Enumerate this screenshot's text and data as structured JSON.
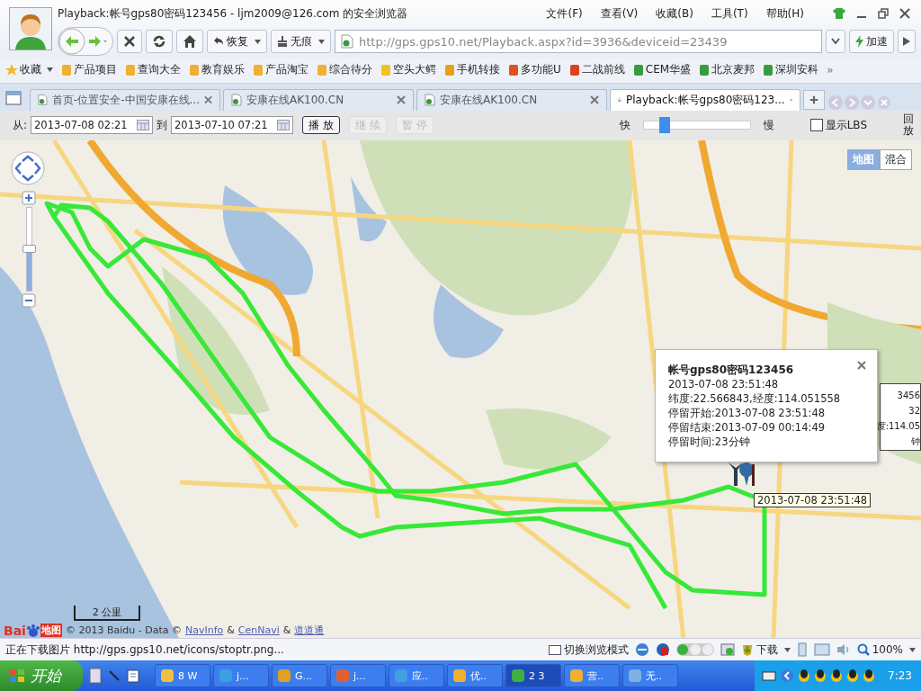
{
  "window": {
    "title": "Playback:帐号gps80密码123456 - ljm2009@126.com 的安全浏览器"
  },
  "menu": [
    "文件(F)",
    "查看(V)",
    "收藏(B)",
    "工具(T)",
    "帮助(H)"
  ],
  "toolbar": {
    "restore": "恢复",
    "incognito": "无痕",
    "address": "http://gps.gps10.net/Playback.aspx?id=3936&deviceid=23439",
    "accelerate": "加速"
  },
  "bookmarks": {
    "favorites": "收藏",
    "items": [
      {
        "label": "产品项目",
        "kind": "folder"
      },
      {
        "label": "查询大全",
        "kind": "folder"
      },
      {
        "label": "教育娱乐",
        "kind": "folder"
      },
      {
        "label": "产品淘宝",
        "kind": "folder"
      },
      {
        "label": "综合待分",
        "kind": "folder"
      },
      {
        "label": "空头大鳄",
        "kind": "hand"
      },
      {
        "label": "手机转接",
        "kind": "flag"
      },
      {
        "label": "多功能U",
        "kind": "tao"
      },
      {
        "label": "二战前线",
        "kind": "pin"
      },
      {
        "label": "CEM华盛",
        "kind": "page"
      },
      {
        "label": "北京麦邦",
        "kind": "page"
      },
      {
        "label": "深圳安科",
        "kind": "page"
      }
    ],
    "more": "»"
  },
  "tabs": [
    {
      "label": "首页-位置安全-中国安康在线...",
      "selected": false
    },
    {
      "label": "安康在线AK100.CN",
      "selected": false
    },
    {
      "label": "安康在线AK100.CN",
      "selected": false
    },
    {
      "label": "Playback:帐号gps80密码123...",
      "selected": true
    }
  ],
  "controls": {
    "from_label": "从:",
    "from": "2013-07-08 02:21",
    "to_label": "到",
    "to": "2013-07-10 07:21",
    "buttons": [
      {
        "label": "播 放",
        "disabled": false
      },
      {
        "label": "继 续",
        "disabled": true
      },
      {
        "label": "暂 停",
        "disabled": true
      }
    ],
    "fast": "快",
    "speed": {
      "level": 0.15
    },
    "slow": "慢",
    "lbs": {
      "label": "显示LBS",
      "checked": false
    },
    "help": "回放"
  },
  "map": {
    "types": [
      {
        "label": "地图",
        "selected": true
      },
      {
        "label": "混合",
        "selected": false
      }
    ],
    "zoom": {
      "level": 0.5
    },
    "back_popup": [
      "3456",
      "32",
      "度:114.05",
      "钟"
    ],
    "popup": {
      "title": "帐号gps80密码123456",
      "lines": [
        "2013-07-08 23:51:48",
        "纬度:22.566843,经度:114.051558",
        "停留开始:2013-07-08 23:51:48",
        "停留结束:2013-07-09 00:14:49",
        "停留时间:23分钟"
      ]
    },
    "marker_label": "2013-07-08 23:51:48",
    "scale": "2 公里",
    "logo": [
      "Bai",
      "地图"
    ],
    "copyright": "© 2013 Baidu - Data ©",
    "links": [
      "NavInfo",
      "CenNavi",
      "道道通"
    ],
    "amp": "&"
  },
  "status_bar": {
    "text": "正在下载图片 http://gps.gps10.net/icons/stoptr.png...",
    "mode": "切换浏览模式",
    "download": "下载",
    "zoom": "100%"
  },
  "taskbar": {
    "start": "开始",
    "tasks": [
      {
        "label": "8 W",
        "selected": false
      },
      {
        "label": "j...",
        "selected": false
      },
      {
        "label": "G...",
        "selected": false
      },
      {
        "label": "j...",
        "selected": false
      },
      {
        "label": "应..",
        "selected": false
      },
      {
        "label": "优..",
        "selected": false
      },
      {
        "label": "2 3",
        "selected": true
      },
      {
        "label": "营..",
        "selected": false
      },
      {
        "label": "无..",
        "selected": false
      }
    ],
    "clock": "7:23"
  }
}
